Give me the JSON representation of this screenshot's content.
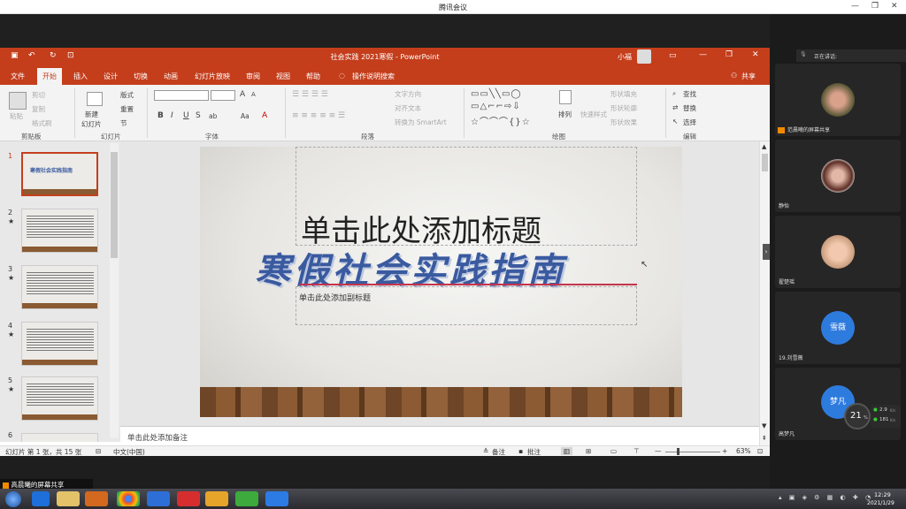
{
  "outer_window": {
    "title": "腾讯会议",
    "controls": [
      "—",
      "❐",
      "✕"
    ]
  },
  "ppt": {
    "title_bar": {
      "doc_title": "社会实践 2021寒假  -  PowerPoint",
      "user": "小福",
      "win_controls": [
        "▭",
        "—",
        "❐",
        "✕"
      ]
    },
    "tabs": [
      "文件",
      "开始",
      "插入",
      "设计",
      "切换",
      "动画",
      "幻灯片放映",
      "审阅",
      "视图",
      "帮助"
    ],
    "active_tab": "开始",
    "tell_me": "操作说明搜索",
    "share": "共享",
    "ribbon": {
      "clipboard": {
        "cut": "剪切",
        "copy": "复制",
        "format_painter": "格式刷",
        "paste": "粘贴",
        "group": "剪贴板"
      },
      "slides": {
        "new_slide_1": "新建",
        "new_slide_2": "幻灯片",
        "layout": "版式",
        "reset": "重置",
        "section": "节",
        "group": "幻灯片"
      },
      "font": {
        "group": "字体",
        "bold": "B",
        "italic": "I",
        "underline": "U",
        "strike": "S",
        "spacing": "ab",
        "case": "Aa",
        "grow": "A",
        "shrink": "A"
      },
      "paragraph": {
        "text_direction": "文字方向",
        "align_text": "对齐文本",
        "smartart": "转换为 SmartArt",
        "group": "段落"
      },
      "drawing": {
        "arrange": "排列",
        "quick_styles": "快速样式",
        "fill": "形状填充",
        "outline": "形状轮廓",
        "effects": "形状效果",
        "group": "绘图"
      },
      "editing": {
        "find": "查找",
        "replace": "替换",
        "select": "选择",
        "group": "编辑"
      }
    },
    "slides_pane": {
      "numbers": [
        "1",
        "2",
        "3",
        "4",
        "5",
        "6"
      ],
      "star": "★"
    },
    "slide": {
      "title_placeholder": "单击此处添加标题",
      "decor_text": "寒假社会实践指南",
      "subtitle_placeholder": "单击此处添加副标题"
    },
    "notes_placeholder": "单击此处添加备注",
    "status": {
      "slide_info": "幻灯片 第 1 张，共 15 张",
      "language": "中文(中国)",
      "notes_btn": "备注",
      "comments_btn": "批注",
      "zoom": "63%",
      "minus": "—",
      "plus": "+"
    }
  },
  "meeting": {
    "speaking_label": "正在讲话:",
    "participants": [
      {
        "name": "范晨曦的屏幕共享"
      },
      {
        "name": "静怡"
      },
      {
        "name": "翟楚瑶"
      },
      {
        "name": "19.刘雪薇",
        "avatar_text": "雪薇"
      },
      {
        "name": "高梦凡",
        "avatar_text": "梦凡"
      }
    ],
    "net_badge": {
      "percent": "21",
      "unit": "%",
      "up": "2.9",
      "down": "181",
      "rate_unit": "K/s"
    },
    "share_label": "高晨曦的屏幕共享"
  },
  "taskbar": {
    "time": "12:29",
    "date": "2021/1/29"
  },
  "colors": {
    "ppt_accent": "#c43e1c",
    "meeting_blue": "#2e7bde",
    "taskbar": "#2a2a30"
  }
}
